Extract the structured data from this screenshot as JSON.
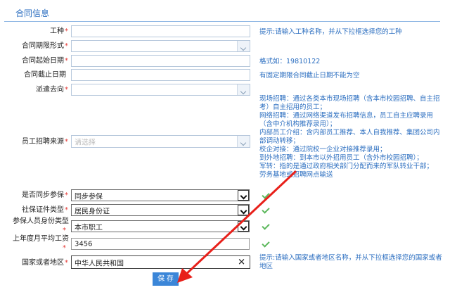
{
  "section": {
    "title": "合同信息"
  },
  "required_mark": "*",
  "fields": {
    "job_type": {
      "label": "工种",
      "value": "",
      "hint": "提示:请输入工种名称，并从下拉框选择您的工种"
    },
    "contract_term_type": {
      "label": "合同期限形式",
      "value": ""
    },
    "contract_start": {
      "label": "合同起始日期",
      "value": "",
      "hint": "格式如：19810122"
    },
    "contract_end": {
      "label": "合同截止日期",
      "value": "",
      "hint": "有固定期限合同截止日期不能为空"
    },
    "dispatch_to": {
      "label": "派遣去向",
      "value": ""
    },
    "recruit_source": {
      "label": "员工招聘来源",
      "placeholder": "请选择",
      "hint_lines": [
        "现场招聘：通过各类本市现场招聘（含本市校园招聘、自主招考）自主招用的员工；",
        "网络招聘：通过网络渠道发布招聘信息，员工自主应聘录用（含中介机构推荐录用）；",
        "内部员工介绍：含内部员工推荐、本人自我推荐、集团公司内部调动转移；",
        "校企对接：通过院校一企业对接推荐录用；",
        "到外地招聘：到本市以外招用员工（含外市校园招聘）；",
        "军转：指的是通过政府相关部门分配而来的军队转业干部；",
        "劳务基地或招聘网点输送"
      ]
    },
    "sync_insurance": {
      "label": "是否同步参保",
      "value": "同步参保"
    },
    "id_type": {
      "label": "社保证件类型",
      "value": "居民身份证"
    },
    "insured_type": {
      "label": "参保人员身份类型",
      "value": "本市职工"
    },
    "last_year_wage": {
      "label": "上年度月平均工资",
      "value": "3456"
    },
    "country": {
      "label": "国家或者地区",
      "value": "中华人民共和国",
      "clear": "✕",
      "hint": "提示:请输入国家或者地区名称，并从下拉框选择您的国家或者地区"
    }
  },
  "save_button": {
    "label": "保 存"
  },
  "colors": {
    "accent": "#2b6ec0",
    "required": "#e53935",
    "valid": "#5cb85c",
    "arrow": "#e8201a",
    "button": "#3b86d8"
  }
}
